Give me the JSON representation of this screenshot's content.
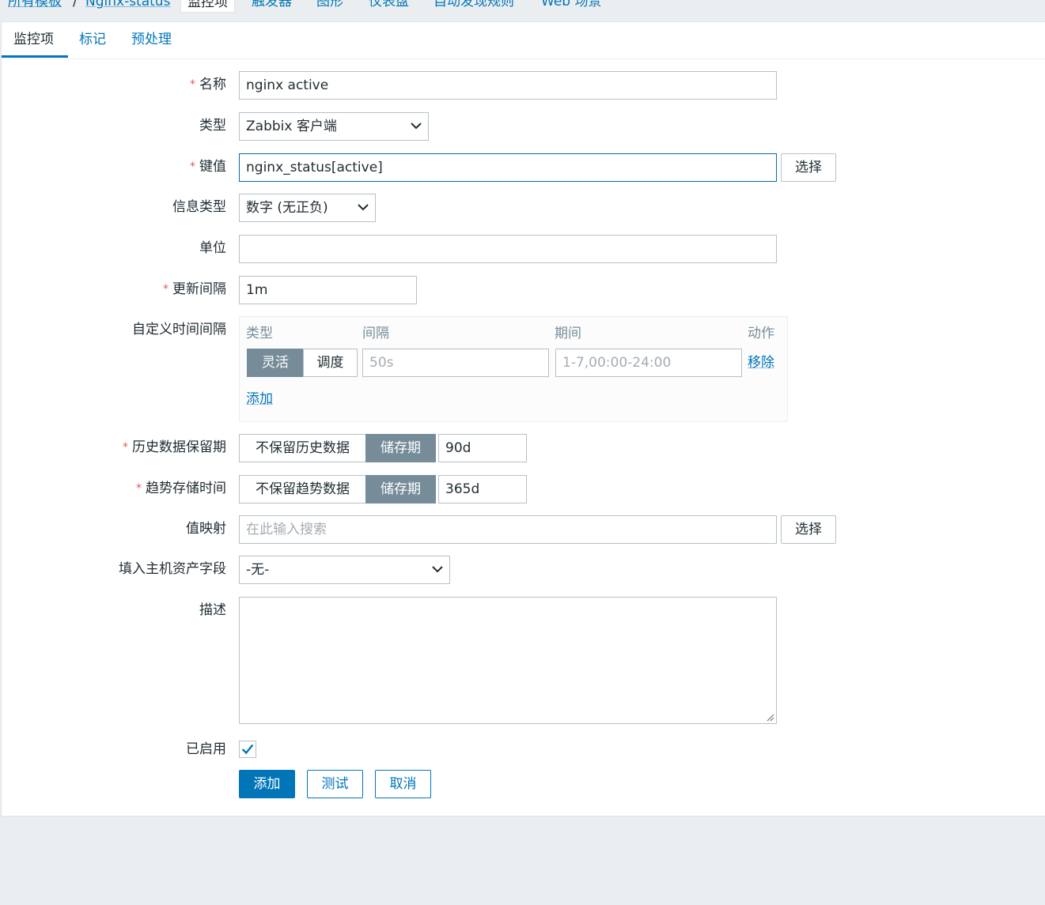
{
  "breadcrumb": {
    "all_templates": "所有模板",
    "separator": "/",
    "template_name": "Nginx-status"
  },
  "top_tabs": [
    "监控项",
    "触发器",
    "图形",
    "仪表盘",
    "自动发现规则",
    "Web 场景"
  ],
  "sub_tabs": [
    "监控项",
    "标记",
    "预处理"
  ],
  "form": {
    "name": {
      "label": "名称",
      "value": "nginx active"
    },
    "type": {
      "label": "类型",
      "value": "Zabbix 客户端"
    },
    "key": {
      "label": "键值",
      "value": "nginx_status[active]",
      "select_label": "选择"
    },
    "info_type": {
      "label": "信息类型",
      "value": "数字 (无正负)"
    },
    "units": {
      "label": "单位",
      "value": ""
    },
    "update_interval": {
      "label": "更新间隔",
      "value": "1m"
    },
    "custom_intervals": {
      "label": "自定义时间间隔",
      "headers": {
        "type": "类型",
        "interval": "间隔",
        "period": "期间",
        "action": "动作"
      },
      "row": {
        "mode_flexible": "灵活",
        "mode_scheduling": "调度",
        "interval_placeholder": "50s",
        "period_placeholder": "1-7,00:00-24:00",
        "remove": "移除"
      },
      "add": "添加"
    },
    "history": {
      "label": "历史数据保留期",
      "option_off": "不保留历史数据",
      "option_on": "储存期",
      "value": "90d"
    },
    "trends": {
      "label": "趋势存储时间",
      "option_off": "不保留趋势数据",
      "option_on": "储存期",
      "value": "365d"
    },
    "value_map": {
      "label": "值映射",
      "placeholder": "在此输入搜索",
      "select_label": "选择"
    },
    "inventory": {
      "label": "填入主机资产字段",
      "value": "-无-"
    },
    "description": {
      "label": "描述",
      "value": ""
    },
    "enabled": {
      "label": "已启用",
      "checked": true
    }
  },
  "buttons": {
    "add": "添加",
    "test": "测试",
    "cancel": "取消"
  },
  "colors": {
    "accent": "#0275b8",
    "required": "#e45959",
    "segment_active": "#768d99",
    "page_bg": "#ebeef0"
  }
}
